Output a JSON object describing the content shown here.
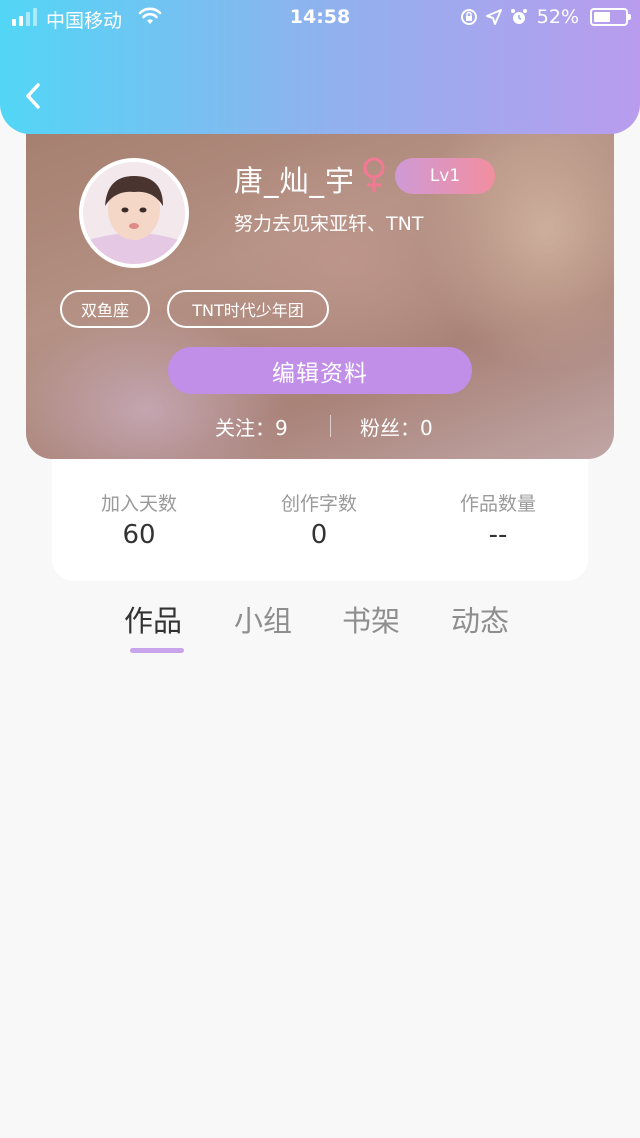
{
  "status_bar": {
    "carrier": "中国移动",
    "time": "14:58",
    "battery_percent": "52%",
    "battery_level": 0.52,
    "icons": [
      "signal-icon",
      "wifi-icon",
      "screen-lock-rotation-icon",
      "location-icon",
      "alarm-icon",
      "battery-icon"
    ]
  },
  "header": {
    "back_icon": "chevron-left-icon",
    "gradient_colors": [
      "#52d6f6",
      "#8fb2ee",
      "#b99ced"
    ]
  },
  "profile": {
    "username": "唐_灿_宇",
    "gender_icon": "female-symbol-icon",
    "gender_color": "#f07a91",
    "level": "Lv1",
    "signature": "努力去见宋亚轩、TNT",
    "tags": [
      "双鱼座",
      "TNT时代少年团"
    ],
    "edit_button_label": "编辑资料",
    "edit_button_color": "#c18ee8",
    "following": "关注：9",
    "followers": "粉丝：0"
  },
  "stats": [
    {
      "label": "加入天数",
      "value": "60"
    },
    {
      "label": "创作字数",
      "value": "0"
    },
    {
      "label": "作品数量",
      "value": "--"
    }
  ],
  "tabs": [
    {
      "label": "作品",
      "active": true
    },
    {
      "label": "小组",
      "active": false
    },
    {
      "label": "书架",
      "active": false
    },
    {
      "label": "动态",
      "active": false
    }
  ],
  "accent_color": "#c8a4ec"
}
